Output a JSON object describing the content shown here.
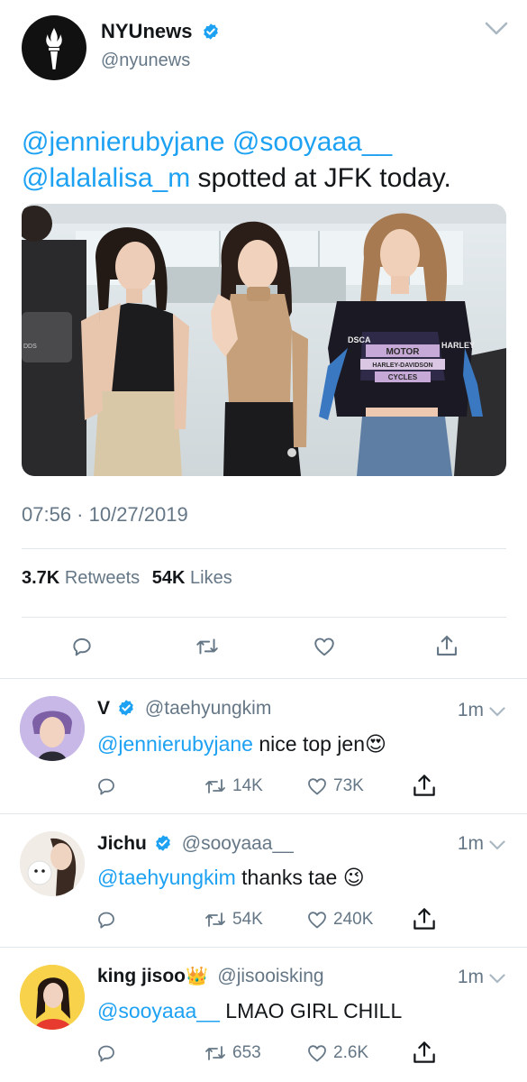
{
  "tweet": {
    "author_name": "NYUnews",
    "author_handle": "@nyunews",
    "text_mentions": "@jennierubyjane @sooyaaa__",
    "text_mention2": "@lalalalisa_m",
    "text_rest": " spotted at JFK today.",
    "timestamp": "07:56 · 10/27/2019",
    "retweets_count": "3.7K",
    "retweets_label": "Retweets",
    "likes_count": "54K",
    "likes_label": "Likes",
    "photo_texts": {
      "motor_text": "MOTOR",
      "brand_text": "HARLEY-DAVIDSON",
      "cycles_text": "CYCLES",
      "sleeve_text": "HARLEY",
      "sleeve_left": "DSCA"
    }
  },
  "replies": [
    {
      "name": "V",
      "verified": true,
      "handle": "@taehyungkim",
      "time": "1m",
      "mention": "@jennierubyjane",
      "text": " nice top jen",
      "emoji": "😍",
      "retweets": "14K",
      "likes": "73K",
      "replies": ""
    },
    {
      "name": "Jichu",
      "verified": true,
      "handle": "@sooyaaa__",
      "time": "1m",
      "mention": "@taehyungkim",
      "text": " thanks tae ",
      "emoji": "😉",
      "retweets": "54K",
      "likes": "240K",
      "replies": ""
    },
    {
      "name": "king jisoo",
      "name_emoji": "👑",
      "verified": false,
      "handle": "@jisooisking",
      "time": "1m",
      "mention": "@sooyaaa__",
      "text": " LMAO GIRL CHILL",
      "emoji": "",
      "retweets": "653",
      "likes": "2.6K",
      "replies": ""
    }
  ],
  "colors": {
    "link": "#1da1f2",
    "muted": "#657786",
    "divider": "#e1e8ed",
    "text": "#14171a"
  },
  "icons": [
    "nyu-torch-icon",
    "verified-badge-icon",
    "chevron-down-icon",
    "reply-icon",
    "retweet-icon",
    "like-icon",
    "share-icon"
  ]
}
